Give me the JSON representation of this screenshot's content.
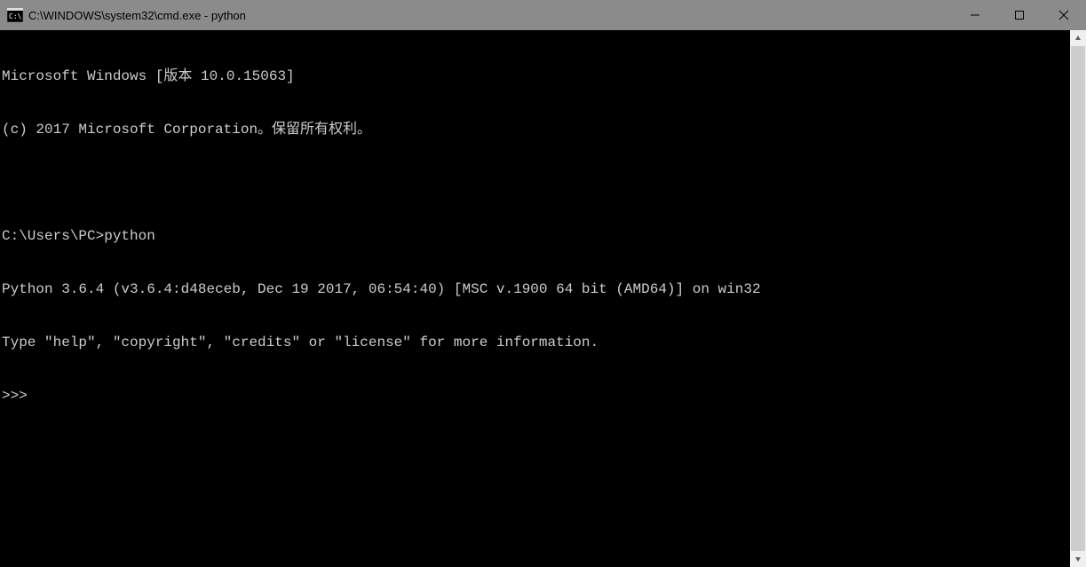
{
  "window": {
    "title": "C:\\WINDOWS\\system32\\cmd.exe - python"
  },
  "terminal": {
    "lines": {
      "l0": "Microsoft Windows [版本 10.0.15063]",
      "l1": "(c) 2017 Microsoft Corporation。保留所有权利。",
      "l2": "",
      "l3_prompt": "C:\\Users\\PC>",
      "l3_cmd": "python",
      "l4": "Python 3.6.4 (v3.6.4:d48eceb, Dec 19 2017, 06:54:40) [MSC v.1900 64 bit (AMD64)] on win32",
      "l5": "Type \"help\", \"copyright\", \"credits\" or \"license\" for more information.",
      "l6": ">>> "
    }
  }
}
